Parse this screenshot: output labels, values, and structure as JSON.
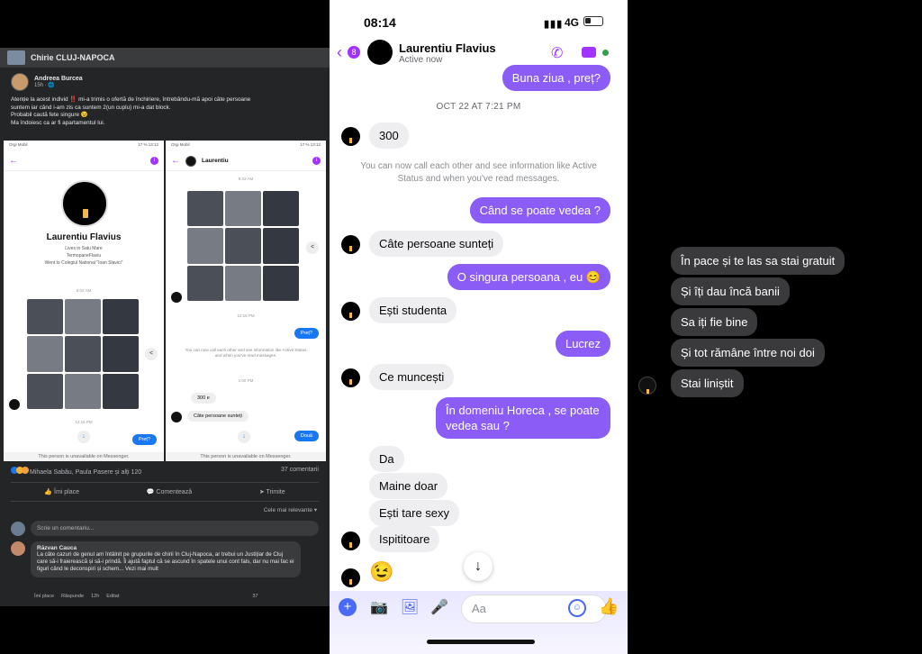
{
  "facebook_post": {
    "group_name": "Chirie CLUJ-NAPOCA",
    "author": "Andreea Burcea",
    "post_time": "15h · ",
    "text_lines": [
      "Atenție la acest individ ‼️ mi-a trimis o ofertă de închiriere, întrebându-mă apoi câte persoane",
      "suntem iar când i-am zis ca suntem 2(un cuplu) mi-a dat block.",
      "Probabil caută fete singure 😉",
      "Ma îndoiesc ca ar fi apartamentul lui."
    ],
    "screenshot_left": {
      "status_left": "Orgi Mobil",
      "status_right": "17 %  13:12",
      "profile_name": "Laurentiu Flavius",
      "lives_in": "Lives in Satu Mare",
      "works_at": "TermopaneFlaviu",
      "education": "Went to Colegiul National \"Ioan Slavici\"",
      "time1": "8:02 AM",
      "time2": "12:16 PM",
      "reply_out": "Preț?",
      "unavailable": "This person is unavailable on Messenger."
    },
    "screenshot_right": {
      "status_left": "Orgi Mobil",
      "status_right": "17 %  13:12",
      "title": "Laurentiu",
      "time1": "8:02 AM",
      "time2": "12:16 PM",
      "price_q": "Preț?",
      "system_text": "You can now call each other and see information like Active Status and when you've read messages.",
      "time3": "1:00 PM",
      "reply_300": "300 e",
      "reply_persons": "Câte persoane sunteți",
      "reply_out": "Două",
      "unavailable": "This person is unavailable on Messenger."
    },
    "reactions": "Mihaela Sabău, Paula Pasere și alți 120",
    "comments_count": "37 comentarii",
    "actions": {
      "like": "Îmi place",
      "comment": "Comentează",
      "share": "Trimite"
    },
    "sort_label": "Cele mai relevante ▾",
    "comment_placeholder": "Scrie un comentariu...",
    "reply": {
      "author": "Răzvan Cauca",
      "text": "La câte cazuri de genul am întâlnit pe grupurile de chirii în Cluj-Napoca, ar trebui un Justițiar de Cluj care să-i fraierească și să-i prindă. Îi ajută faptul că se ascund în spatele unui cont fals, dar nu mai fac ei figuri când le deconspiri și schem... Vezi mai mult",
      "like": "Îmi place",
      "respond": "Răspunde",
      "time": "12h",
      "edited": "Editat",
      "react_count": "37"
    }
  },
  "messenger": {
    "status_time": "08:14",
    "signal": "▮▮▮",
    "network": "4G",
    "back_count": "8",
    "contact_name": "Laurentiu Flavius",
    "contact_status": "Active now",
    "messages": {
      "m1": "Buna ziua , preț?",
      "date": "OCT 22 AT 7:21 PM",
      "m2": "300",
      "system": "You can now call each other and see information like Active Status and when you've read messages.",
      "m3": "Când se poate vedea ?",
      "m4": "Câte persoane sunteți",
      "m5": "O singura persoana , eu 😊",
      "m6": "Ești studenta",
      "m7": "Lucrez",
      "m8": "Ce muncești",
      "m9": "În domeniu Horeca , se poate vedea sau ?",
      "m10": "Da",
      "m11": "Maine doar",
      "m12": "Ești tare sexy",
      "m13": "Ispititoare",
      "m14": "😉"
    },
    "compose_placeholder": "Aa",
    "colors": {
      "accent": "#a033ff",
      "outgoing_bubble": "#8b5cf6",
      "composer_icons": "#4a69f5"
    }
  },
  "dark_chat": {
    "messages": [
      "În pace și te las sa stai gratuit",
      "Și îți dau încă banii",
      "Sa iți fie bine",
      "Și tot rămâne între noi doi",
      "Stai liniștit"
    ]
  }
}
